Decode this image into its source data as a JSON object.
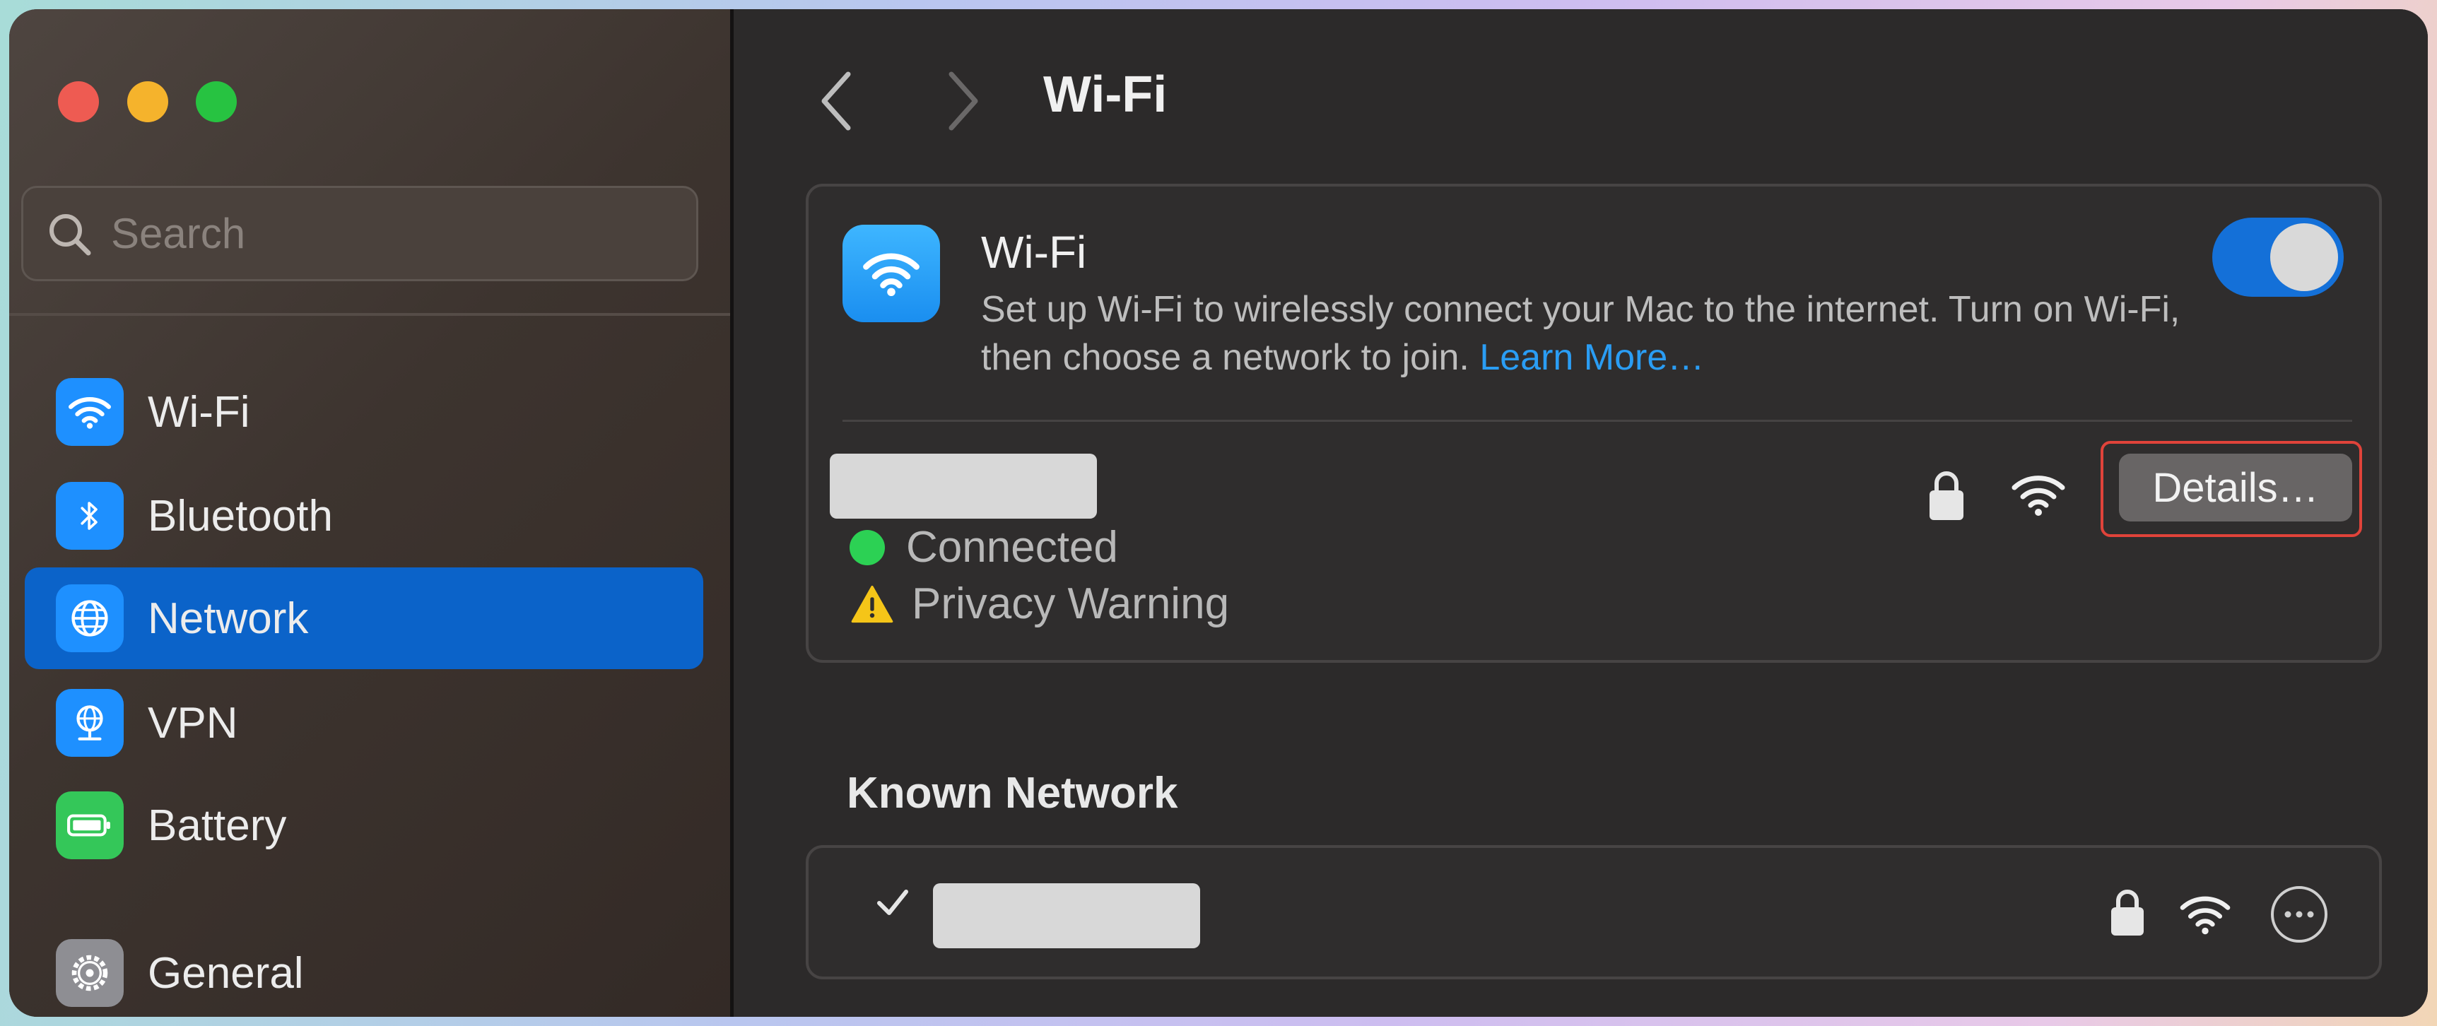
{
  "window": {
    "title": "Wi-Fi"
  },
  "sidebar": {
    "search": {
      "placeholder": "Search",
      "icon": "magnifying-glass-icon"
    },
    "items": [
      {
        "label": "Wi-Fi",
        "icon": "wifi-icon",
        "color": "#1e90ff",
        "selected": false
      },
      {
        "label": "Bluetooth",
        "icon": "bluetooth-icon",
        "color": "#1e90ff",
        "selected": false
      },
      {
        "label": "Network",
        "icon": "globe-icon",
        "color": "#1e90ff",
        "selected": true
      },
      {
        "label": "VPN",
        "icon": "vpn-globe-icon",
        "color": "#1e90ff",
        "selected": false
      },
      {
        "label": "Battery",
        "icon": "battery-icon",
        "color": "#34c759",
        "selected": false
      },
      {
        "label": "General",
        "icon": "gear-icon",
        "color": "#8e8e93",
        "selected": false
      }
    ]
  },
  "main": {
    "wifi_card": {
      "title": "Wi-Fi",
      "description": "Set up Wi-Fi to wirelessly connect your Mac to the internet. Turn on Wi-Fi, then choose a network to join.",
      "learn_more": "Learn More…",
      "toggle_on": true
    },
    "current_network": {
      "status": "Connected",
      "warning": "Privacy Warning",
      "details_button": "Details…"
    },
    "known_networks": {
      "heading": "Known Network"
    }
  },
  "colors": {
    "accent": "#0b63c9",
    "link": "#2a9df4",
    "connected": "#2cd154",
    "warning": "#f5c518",
    "highlight_outline": "#e0433a"
  }
}
